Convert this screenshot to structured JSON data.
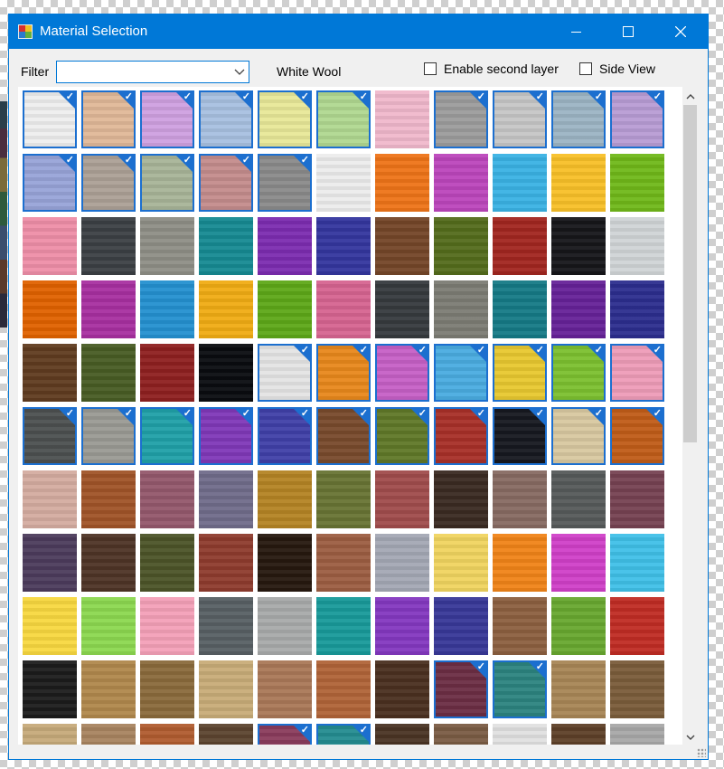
{
  "window": {
    "title": "Material Selection"
  },
  "controls": {
    "filter_label": "Filter",
    "filter_value": "",
    "selected_material": "White Wool",
    "second_layer_label": "Enable second layer",
    "second_layer_checked": false,
    "side_view_label": "Side View",
    "side_view_checked": false
  },
  "icons": {
    "app": "app-icon",
    "minimize": "minimize-icon",
    "maximize": "maximize-icon",
    "close": "close-icon",
    "dropdown": "chevron-down-icon",
    "scroll_up": "chevron-up-icon",
    "scroll_down": "chevron-down-icon"
  },
  "colors": {
    "accent": "#0078d7",
    "selected_border": "#1c6fcf"
  },
  "materials": [
    [
      [
        "#eeeeee",
        1
      ],
      [
        "#e0b898",
        1
      ],
      [
        "#cfa0e0",
        1
      ],
      [
        "#a8c0e0",
        1
      ],
      [
        "#e8e898",
        1
      ],
      [
        "#b0d890",
        1
      ],
      [
        "#f0b8cc",
        0
      ],
      [
        "#9c9c9c",
        1
      ],
      [
        "#c6c6c6",
        1
      ],
      [
        "#9cb4c4",
        1
      ],
      [
        "#b89cd4",
        1
      ]
    ],
    [
      [
        "#98a4d8",
        1
      ],
      [
        "#aca096",
        1
      ],
      [
        "#a8b498",
        1
      ],
      [
        "#c48c8c",
        1
      ],
      [
        "#8a8a8a",
        1
      ],
      [
        "#ececec",
        0
      ],
      [
        "#ee7418",
        0
      ],
      [
        "#bc46bc",
        0
      ],
      [
        "#3ab2e4",
        0
      ],
      [
        "#f8c028",
        0
      ],
      [
        "#70b81a",
        0
      ]
    ],
    [
      [
        "#ee8ea8",
        0
      ],
      [
        "#3c4044",
        0
      ],
      [
        "#8e8e86",
        0
      ],
      [
        "#168a92",
        0
      ],
      [
        "#7c2cb0",
        0
      ],
      [
        "#34369e",
        0
      ],
      [
        "#744628",
        0
      ],
      [
        "#546c1c",
        0
      ],
      [
        "#a22620",
        0
      ],
      [
        "#16161a",
        0
      ],
      [
        "#d0d4d6",
        0
      ]
    ],
    [
      [
        "#e06200",
        0
      ],
      [
        "#a830a0",
        0
      ],
      [
        "#2490d0",
        0
      ],
      [
        "#f0ac14",
        0
      ],
      [
        "#5ea818",
        0
      ],
      [
        "#d66490",
        0
      ],
      [
        "#363a3e",
        0
      ],
      [
        "#7c7c74",
        0
      ],
      [
        "#157a86",
        0
      ],
      [
        "#662298",
        0
      ],
      [
        "#2c2e8e",
        0
      ]
    ],
    [
      [
        "#603c20",
        0
      ],
      [
        "#485c24",
        0
      ],
      [
        "#8e2020",
        0
      ],
      [
        "#0a0c10",
        0
      ],
      [
        "#e4e4e4",
        1
      ],
      [
        "#e8881c",
        1
      ],
      [
        "#c660c6",
        1
      ],
      [
        "#4aace0",
        1
      ],
      [
        "#e8c830",
        1
      ],
      [
        "#7cc030",
        1
      ],
      [
        "#ee9cb8",
        1
      ]
    ],
    [
      [
        "#4c5050",
        1
      ],
      [
        "#9a9a94",
        1
      ],
      [
        "#20a0a8",
        1
      ],
      [
        "#8038b8",
        1
      ],
      [
        "#4040a8",
        1
      ],
      [
        "#784a2c",
        1
      ],
      [
        "#607828",
        1
      ],
      [
        "#a83028",
        1
      ],
      [
        "#161820",
        1
      ],
      [
        "#d8c8a0",
        1
      ],
      [
        "#c05c18",
        1
      ]
    ],
    [
      [
        "#d4aca0",
        0
      ],
      [
        "#a05428",
        0
      ],
      [
        "#94586c",
        0
      ],
      [
        "#706c8a",
        0
      ],
      [
        "#b48424",
        0
      ],
      [
        "#687434",
        0
      ],
      [
        "#a04c4c",
        0
      ],
      [
        "#3a2a22",
        0
      ],
      [
        "#876a62",
        0
      ],
      [
        "#565a5a",
        0
      ],
      [
        "#764252",
        0
      ]
    ],
    [
      [
        "#4c3c5c",
        0
      ],
      [
        "#4e3426",
        0
      ],
      [
        "#4c5428",
        0
      ],
      [
        "#8e3c2e",
        0
      ],
      [
        "#26180f",
        0
      ],
      [
        "#9c5e42",
        0
      ],
      [
        "#a4a8b4",
        0
      ],
      [
        "#f0d460",
        0
      ],
      [
        "#f08418",
        0
      ],
      [
        "#d040c8",
        0
      ],
      [
        "#40c0e8",
        0
      ]
    ],
    [
      [
        "#f8d840",
        0
      ],
      [
        "#8cd850",
        0
      ],
      [
        "#f4a0b8",
        0
      ],
      [
        "#586064",
        0
      ],
      [
        "#a8aaaa",
        0
      ],
      [
        "#189a9a",
        0
      ],
      [
        "#8438c0",
        0
      ],
      [
        "#383898",
        0
      ],
      [
        "#8c6040",
        0
      ],
      [
        "#68a830",
        0
      ],
      [
        "#c02c24",
        0
      ]
    ],
    [
      [
        "#1c1c1c",
        0
      ],
      [
        "#b0884c",
        0
      ],
      [
        "#8a6a3c",
        0
      ],
      [
        "#c8ac78",
        0
      ],
      [
        "#aa7858",
        0
      ],
      [
        "#b06438",
        0
      ],
      [
        "#4a3020",
        0
      ],
      [
        "#6c2e44",
        1
      ],
      [
        "#2c8480",
        1
      ],
      [
        "#a88656",
        0
      ],
      [
        "#7a5c3a",
        0
      ]
    ],
    [
      [
        "#c6aa7a",
        0
      ],
      [
        "#a88460",
        0
      ],
      [
        "#b05c30",
        0
      ],
      [
        "#5c4430",
        0
      ],
      [
        "#8a3c5c",
        1
      ],
      [
        "#248c90",
        1
      ],
      [
        "#4a3424",
        0
      ],
      [
        "#7a5c44",
        0
      ],
      [
        "#e0e0e0",
        0
      ],
      [
        "#5e4028",
        0
      ],
      [
        "#a8a8a8",
        0
      ]
    ]
  ]
}
